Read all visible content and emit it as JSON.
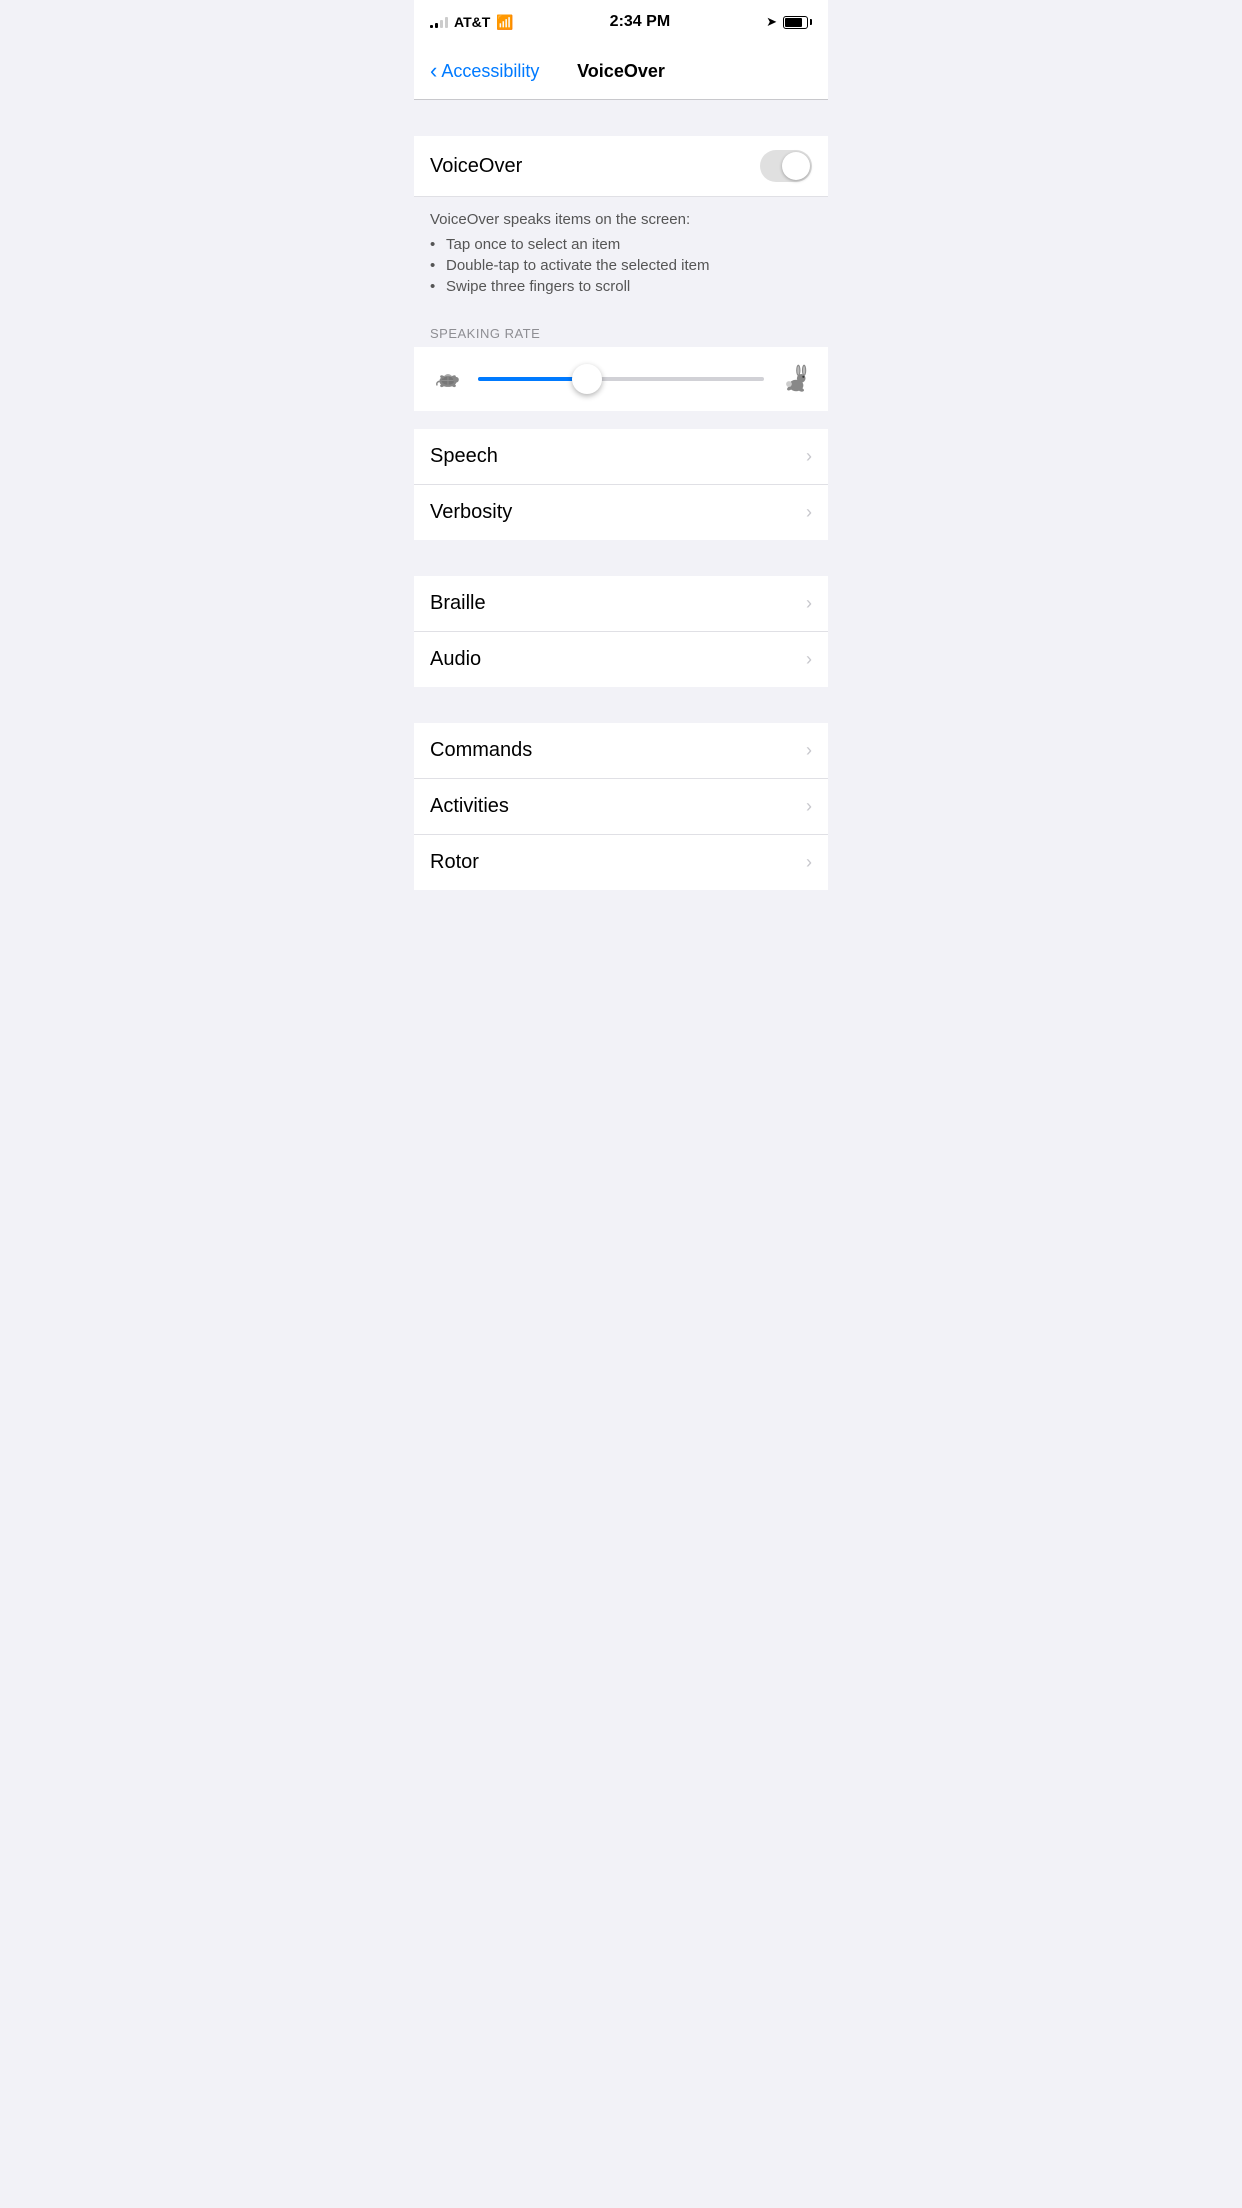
{
  "statusBar": {
    "carrier": "AT&T",
    "time": "2:34 PM"
  },
  "navBar": {
    "backLabel": "Accessibility",
    "title": "VoiceOver"
  },
  "voiceOverSection": {
    "toggleLabel": "VoiceOver",
    "toggleEnabled": false,
    "descriptionTitle": "VoiceOver speaks items on the screen:",
    "descriptionItems": [
      "Tap once to select an item",
      "Double-tap to activate the selected item",
      "Swipe three fingers to scroll"
    ]
  },
  "speakingRate": {
    "sectionHeader": "SPEAKING RATE",
    "sliderValue": 38
  },
  "menuItems": [
    {
      "id": "speech",
      "label": "Speech"
    },
    {
      "id": "verbosity",
      "label": "Verbosity"
    }
  ],
  "menuItems2": [
    {
      "id": "braille",
      "label": "Braille"
    },
    {
      "id": "audio",
      "label": "Audio"
    }
  ],
  "menuItems3": [
    {
      "id": "commands",
      "label": "Commands"
    },
    {
      "id": "activities",
      "label": "Activities"
    },
    {
      "id": "rotor",
      "label": "Rotor"
    }
  ]
}
